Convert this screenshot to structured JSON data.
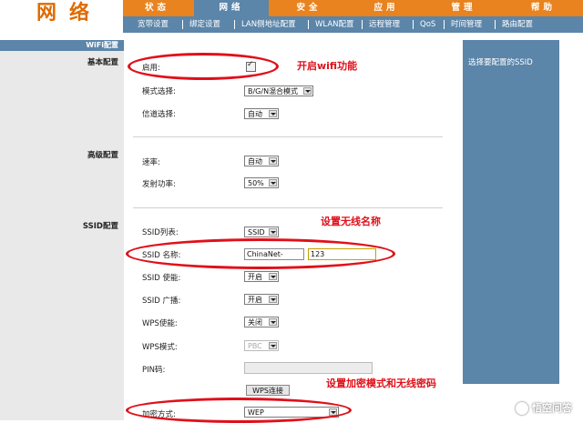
{
  "header": {
    "title": "网络"
  },
  "main_nav": [
    {
      "label": "状态"
    },
    {
      "label": "网络"
    },
    {
      "label": "安全"
    },
    {
      "label": "应用"
    },
    {
      "label": "管理"
    },
    {
      "label": "帮助"
    }
  ],
  "main_nav_active": "网络",
  "sub_nav": [
    {
      "label": "宽带设置"
    },
    {
      "label": "绑定设置"
    },
    {
      "label": "LAN侧地址配置"
    },
    {
      "label": "WLAN配置"
    },
    {
      "label": "远程管理"
    },
    {
      "label": "QoS"
    },
    {
      "label": "时间管理"
    },
    {
      "label": "路由配置"
    }
  ],
  "sub_nav_active": "WLAN配置",
  "left": {
    "header": "WiFi配置",
    "sections": {
      "basic": "基本配置",
      "advanced": "高级配置",
      "ssid": "SSID配置"
    }
  },
  "form": {
    "enable_label": "启用:",
    "enable_checked": true,
    "mode_label": "模式选择:",
    "mode_value": "B/G/N混合模式",
    "channel_label": "信道选择:",
    "channel_value": "自动",
    "rate_label": "速率:",
    "rate_value": "自动",
    "power_label": "发射功率:",
    "power_value": "50%",
    "ssid_list_label": "SSID列表:",
    "ssid_list_value": "SSID",
    "ssid_name_label": "SSID 名称:",
    "ssid_prefix": "ChinaNet-",
    "ssid_suffix": "123",
    "ssid_enable_label": "SSID 使能:",
    "ssid_enable_value": "开启",
    "ssid_broadcast_label": "SSID 广播:",
    "ssid_broadcast_value": "开启",
    "wps_enable_label": "WPS使能:",
    "wps_enable_value": "关闭",
    "wps_mode_label": "WPS模式:",
    "wps_mode_value": "PBC",
    "pin_label": "PIN码:",
    "pin_value": "",
    "wps_button": "WPS连接",
    "encryption_label": "加密方式:",
    "encryption_value": "WEP"
  },
  "annotations": {
    "enable_wifi": "开启wifi功能",
    "set_ssid": "设置无线名称",
    "set_encryption": "设置加密模式和无线密码"
  },
  "help": {
    "text": "选择要配置的SSID"
  },
  "watermark": {
    "text": "悟空问答"
  },
  "colors": {
    "nav_orange": "#e8831f",
    "nav_blue": "#5b85a9",
    "annotation_red": "#e0101a"
  }
}
